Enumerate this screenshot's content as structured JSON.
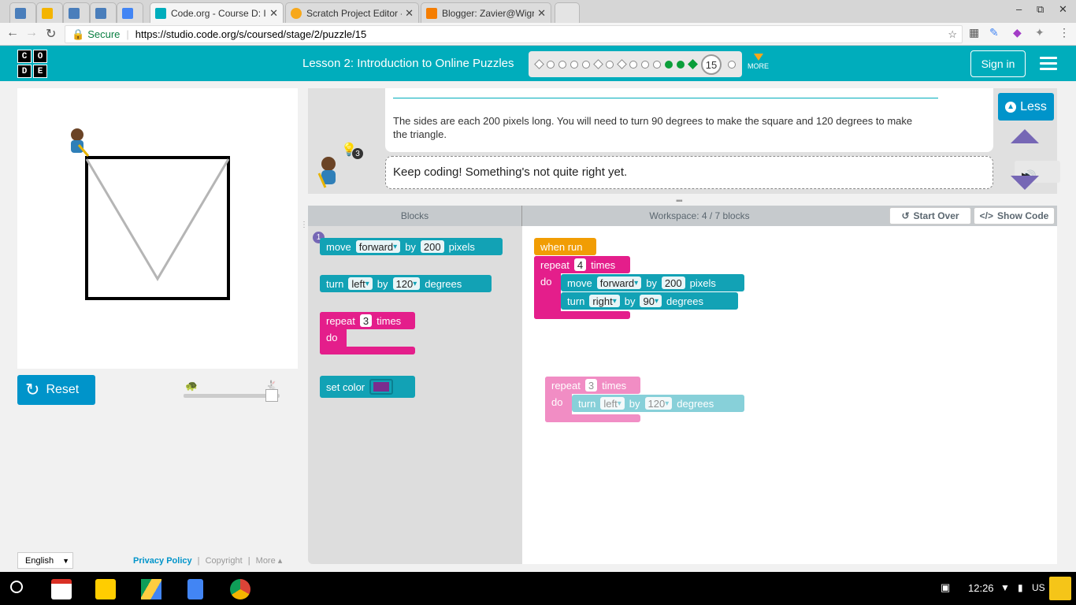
{
  "browser": {
    "tabs": [
      {
        "title": "",
        "favicon_color": "#4a7ebb"
      },
      {
        "title": "",
        "favicon_color": "#f4b400"
      },
      {
        "title": "",
        "favicon_color": "#4a7ebb"
      },
      {
        "title": "",
        "favicon_color": "#4a7ebb"
      },
      {
        "title": "",
        "favicon_color": "#4285f4"
      },
      {
        "title": "Code.org - Course D: Intr",
        "favicon_color": "#00adbc",
        "active": true
      },
      {
        "title": "Scratch Project Editor - I",
        "favicon_color": "#f7a81b"
      },
      {
        "title": "Blogger: Zavier@Wigram",
        "favicon_color": "#f57d00"
      }
    ],
    "close_glyph": "✕",
    "window_controls": {
      "minimize": "–",
      "restore": "⧉",
      "close": "✕"
    },
    "secure_label": "Secure",
    "url": "https://studio.code.org/s/coursed/stage/2/puzzle/15"
  },
  "header": {
    "logo_letters": [
      "C",
      "O",
      "D",
      "E"
    ],
    "lesson_title": "Lesson 2: Introduction to Online Puzzles",
    "current_puzzle": "15",
    "more_label": "MORE",
    "sign_in_label": "Sign in"
  },
  "visualization": {
    "reset_label": "Reset"
  },
  "footer": {
    "language": "English",
    "privacy_policy": "Privacy Policy",
    "copyright": "Copyright",
    "more": "More",
    "separator": "|"
  },
  "instructions": {
    "text": "The sides are each 200 pixels long. You will need to turn 90 degrees to make the square and 120 degrees to make the triangle.",
    "feedback": "Keep coding! Something's not quite right yet.",
    "hint_count": "3",
    "less_label": "Less"
  },
  "toolbox": {
    "header": "Blocks",
    "badge": "1",
    "move_block": {
      "label": "move",
      "direction": "forward",
      "by": "by",
      "distance": "200",
      "unit": "pixels"
    },
    "turn_block": {
      "label": "turn",
      "direction": "left",
      "by": "by",
      "angle": "120",
      "unit": "degrees"
    },
    "repeat_block": {
      "label": "repeat",
      "count": "3",
      "times": "times",
      "do": "do"
    },
    "color_block": {
      "label": "set color",
      "color": "#7b2d8e"
    }
  },
  "workspace": {
    "header": "Workspace: 4 / 7 blocks",
    "start_over_label": "Start Over",
    "show_code_label": "Show Code",
    "when_run": "when run",
    "repeat_main": {
      "label": "repeat",
      "count": "4",
      "times": "times",
      "do": "do"
    },
    "move_main": {
      "label": "move",
      "direction": "forward",
      "by": "by",
      "distance": "200",
      "unit": "pixels"
    },
    "turn_main": {
      "label": "turn",
      "direction": "right",
      "by": "by",
      "angle": "90",
      "unit": "degrees"
    },
    "repeat_ghost": {
      "label": "repeat",
      "count": "3",
      "times": "times",
      "do": "do"
    },
    "turn_ghost": {
      "label": "turn",
      "direction": "left",
      "by": "by",
      "angle": "120",
      "unit": "degrees"
    }
  },
  "taskbar": {
    "time": "12:26",
    "locale": "US"
  },
  "colors": {
    "brand_teal": "#00adbc",
    "button_blue": "#0094ca",
    "block_teal": "#12a2b5",
    "block_pink": "#e41e8b",
    "block_orange": "#f19d04",
    "progress_green": "#0b9e3a"
  }
}
